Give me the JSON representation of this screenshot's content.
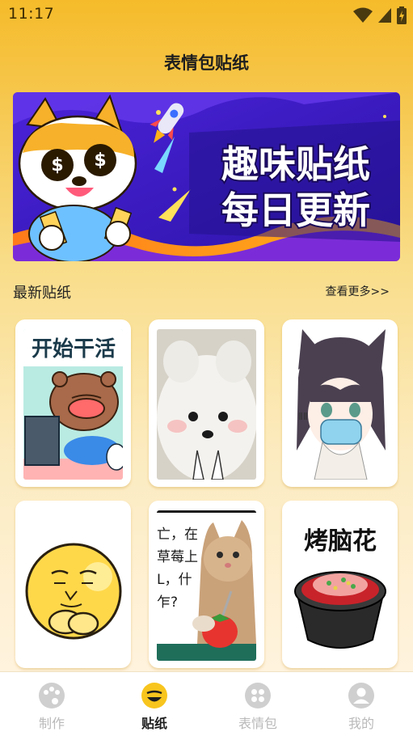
{
  "status_bar": {
    "time": "11:17"
  },
  "header": {
    "title": "表情包贴纸"
  },
  "banner": {
    "line1": "趣味贴纸",
    "line2": "每日更新"
  },
  "latest": {
    "title": "最新贴纸",
    "more_label": "查看更多>>"
  },
  "stickers": [
    {
      "name": "sticker-start-work",
      "caption": "开始干活"
    },
    {
      "name": "sticker-white-dog",
      "caption": ""
    },
    {
      "name": "sticker-mask-girl",
      "caption": ""
    },
    {
      "name": "sticker-yellow-ball",
      "caption": ""
    },
    {
      "name": "sticker-cat-strawberry",
      "caption_lines": [
        "亡，在",
        "草莓上",
        "L，什",
        "乍?"
      ]
    },
    {
      "name": "sticker-brain-flower",
      "caption": "烤脑花"
    }
  ],
  "tabbar": {
    "items": [
      {
        "label": "制作",
        "icon": "palette-icon",
        "active": false
      },
      {
        "label": "贴纸",
        "icon": "smiley-icon",
        "active": true
      },
      {
        "label": "表情包",
        "icon": "grid-icon",
        "active": false
      },
      {
        "label": "我的",
        "icon": "person-icon",
        "active": false
      }
    ]
  },
  "colors": {
    "accent": "#f5b82a",
    "banner_bg": "#3b1fc6",
    "tab_active": "#1e1e1e",
    "tab_inactive": "#b9b9b9"
  }
}
